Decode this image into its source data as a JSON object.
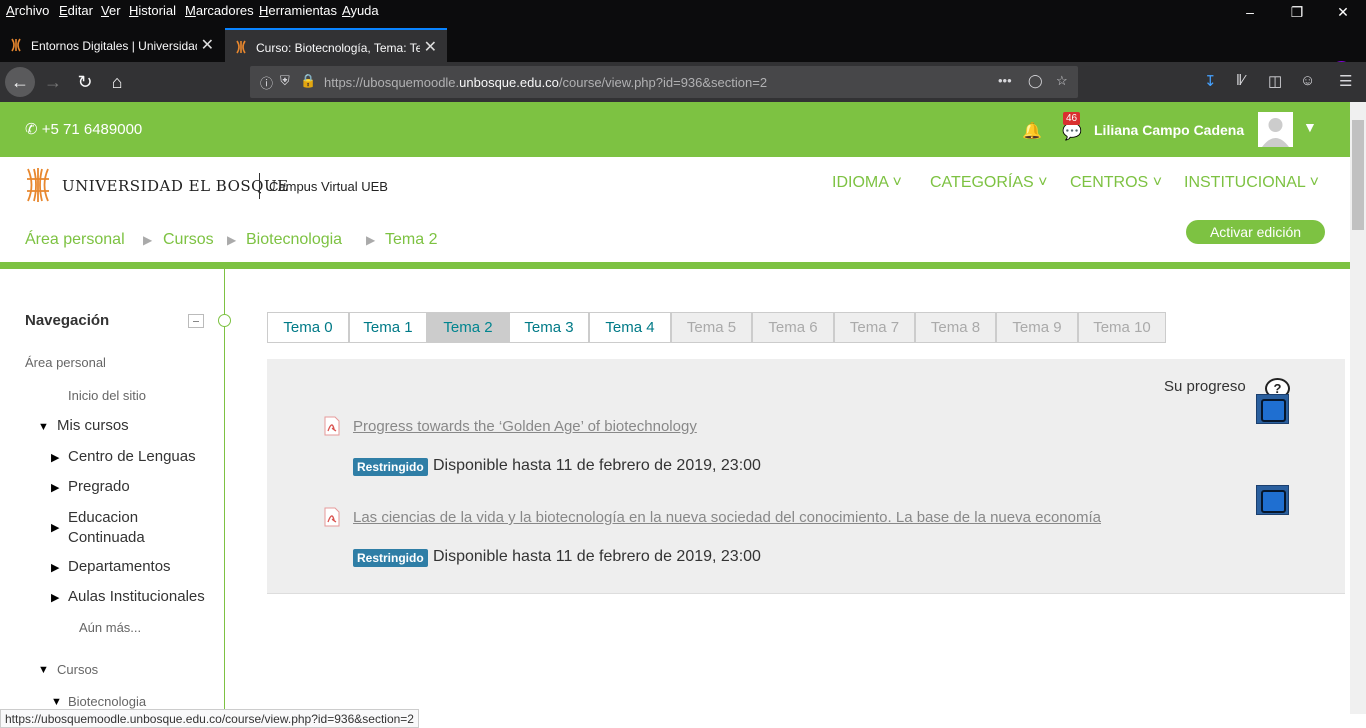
{
  "browser": {
    "menu": [
      "Archivo",
      "Editar",
      "Ver",
      "Historial",
      "Marcadores",
      "Herramientas",
      "Ayuda"
    ],
    "tabs": [
      {
        "title": "Entornos Digitales | Universidad"
      },
      {
        "title": "Curso: Biotecnología, Tema: Te"
      }
    ],
    "url_prefix": "https://ubosquemoodle.",
    "url_domain": "unbosque.edu.co",
    "url_suffix": "/course/view.php?id=936&section=2",
    "status_url": "https://ubosquemoodle.unbosque.edu.co/course/view.php?id=936&section=2"
  },
  "header": {
    "phone": "+5 71 6489000",
    "notifications_count": "46",
    "user_name": "Liliana Campo Cadena"
  },
  "brand": {
    "name": "UNIVERSIDAD EL BOSQUE",
    "campus": "Campus Virtual UEB"
  },
  "topnav": [
    "IDIOMA",
    "CATEGORÍAS",
    "CENTROS",
    "INSTITUCIONAL"
  ],
  "breadcrumb": [
    "Área personal",
    "Cursos",
    "Biotecnologia",
    "Tema 2"
  ],
  "edit_button": "Activar edición",
  "navigation": {
    "title": "Navegación",
    "personal_area": "Área personal",
    "site_home": "Inicio del sitio",
    "my_courses": "Mis cursos",
    "course_items": [
      "Centro de Lenguas",
      "Pregrado",
      "Educacion Continuada",
      "Departamentos",
      "Aulas Institucionales"
    ],
    "more": "Aún más...",
    "courses": "Cursos",
    "course_current": "Biotecnologia"
  },
  "topic_tabs": [
    {
      "label": "Tema 0",
      "state": "normal"
    },
    {
      "label": "Tema 1",
      "state": "normal"
    },
    {
      "label": "Tema 2",
      "state": "active"
    },
    {
      "label": "Tema 3",
      "state": "normal"
    },
    {
      "label": "Tema 4",
      "state": "normal"
    },
    {
      "label": "Tema 5",
      "state": "disabled"
    },
    {
      "label": "Tema 6",
      "state": "disabled"
    },
    {
      "label": "Tema 7",
      "state": "disabled"
    },
    {
      "label": "Tema 8",
      "state": "disabled"
    },
    {
      "label": "Tema 9",
      "state": "disabled"
    },
    {
      "label": "Tema 10",
      "state": "disabled"
    }
  ],
  "section": {
    "progress_label": "Su progreso",
    "activities": [
      {
        "title": "Progress towards the ‘Golden Age’ of biotechnology",
        "badge": "Restringido",
        "availability": "Disponible hasta 11 de febrero de 2019, 23:00"
      },
      {
        "title": "Las ciencias de la vida y la biotecnología en la nueva sociedad del conocimiento. La base de la nueva economía",
        "badge": "Restringido",
        "availability": "Disponible hasta 11 de febrero de 2019, 23:00"
      }
    ]
  },
  "colors": {
    "brand_green": "#7dc242",
    "tab_text": "#007a87",
    "badge_blue": "#2f7ea6",
    "browser_dark": "#0c0c0d"
  }
}
